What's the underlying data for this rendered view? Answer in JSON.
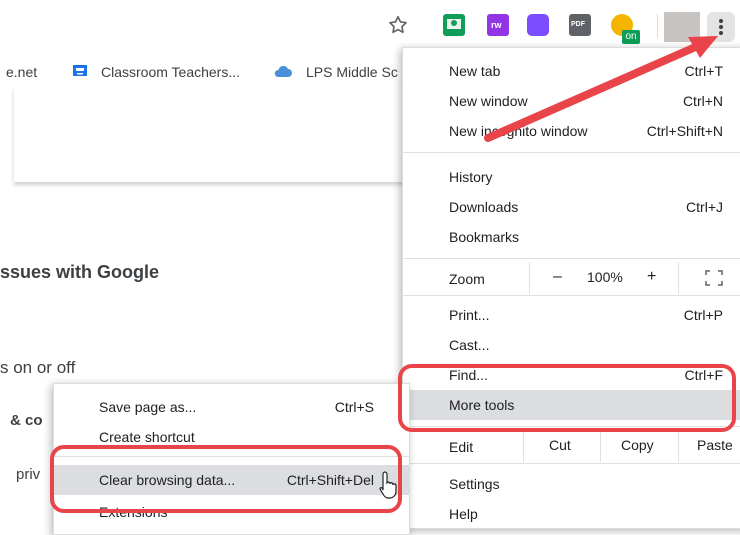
{
  "toolbar": {
    "star_icon": "star-outline-icon",
    "extension_badge": "on",
    "menu_icon": "three-dot-vertical-icon",
    "extension_colors": [
      "#0f9d58",
      "#9334e6",
      "#7c4dff",
      "#5f6368",
      "#f4b400"
    ]
  },
  "bookmarks": [
    {
      "label": "e.net",
      "icon": "none"
    },
    {
      "label": "Classroom Teachers...",
      "icon": "classroom-icon"
    },
    {
      "label": "LPS Middle Sc",
      "icon": "cloud-icon"
    }
  ],
  "page": {
    "heading": "ssues with Google",
    "line1": "s on or off",
    "line2": "& co",
    "line3": "priv"
  },
  "menu": {
    "new_tab": {
      "label": "New tab",
      "shortcut": "Ctrl+T"
    },
    "new_window": {
      "label": "New window",
      "shortcut": "Ctrl+N"
    },
    "new_incognito": {
      "label": "New incognito window",
      "shortcut": "Ctrl+Shift+N"
    },
    "history": {
      "label": "History"
    },
    "downloads": {
      "label": "Downloads",
      "shortcut": "Ctrl+J"
    },
    "bookmarks": {
      "label": "Bookmarks"
    },
    "zoom": {
      "label": "Zoom",
      "minus": "–",
      "value": "100%",
      "plus": "+"
    },
    "print": {
      "label": "Print...",
      "shortcut": "Ctrl+P"
    },
    "cast": {
      "label": "Cast..."
    },
    "find": {
      "label": "Find...",
      "shortcut": "Ctrl+F"
    },
    "more_tools": {
      "label": "More tools"
    },
    "edit": {
      "label": "Edit",
      "cut": "Cut",
      "copy": "Copy",
      "paste": "Paste"
    },
    "settings": {
      "label": "Settings"
    },
    "help": {
      "label": "Help"
    }
  },
  "submenu": {
    "save_page": {
      "label": "Save page as...",
      "shortcut": "Ctrl+S"
    },
    "create_shortcut": {
      "label": "Create shortcut"
    },
    "clear_browsing": {
      "label": "Clear browsing data...",
      "shortcut": "Ctrl+Shift+Del"
    },
    "extensions": {
      "label": "Extensions"
    }
  },
  "annotation_color": "#e8444a"
}
